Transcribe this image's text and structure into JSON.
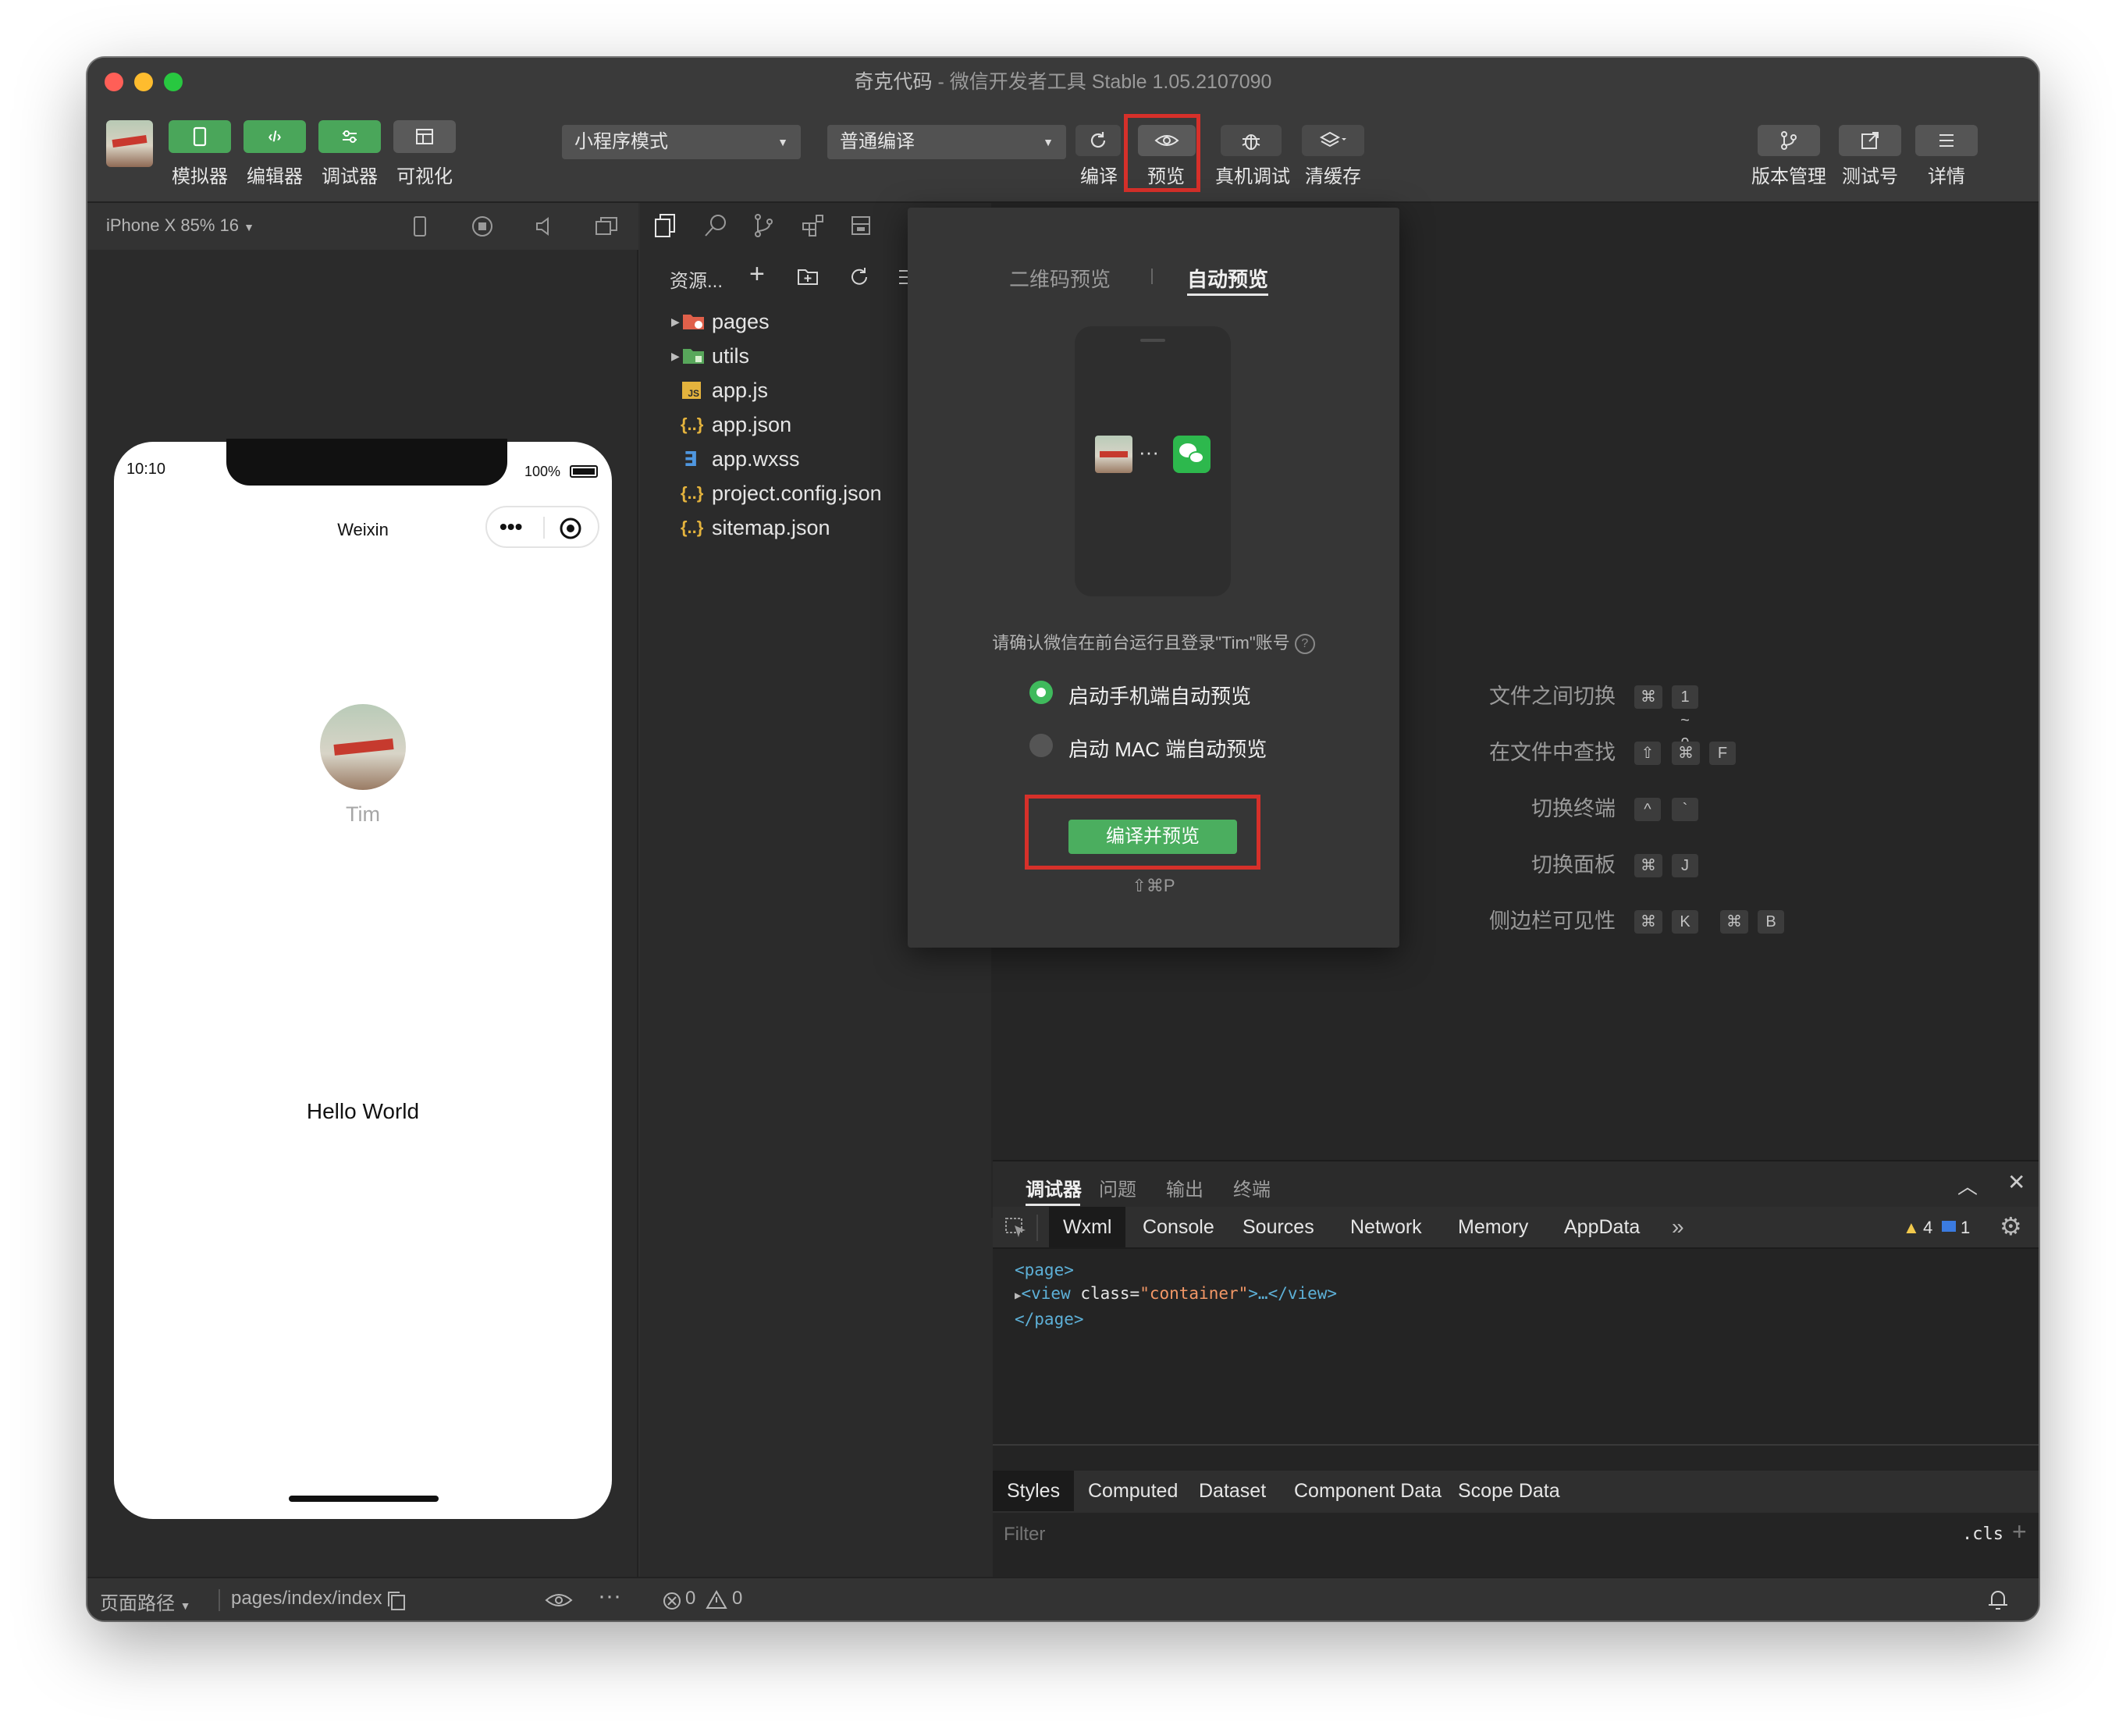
{
  "window": {
    "title_app": "奇克代码",
    "title_rest": " - 微信开发者工具 Stable 1.05.2107090"
  },
  "toolbar": {
    "left_buttons": [
      {
        "label": "模拟器",
        "icon": "phone-icon"
      },
      {
        "label": "编辑器",
        "icon": "code-icon"
      },
      {
        "label": "调试器",
        "icon": "debug-icon"
      },
      {
        "label": "可视化",
        "icon": "layout-icon"
      }
    ],
    "mode_select": "小程序模式",
    "compile_select": "普通编译",
    "compile_label": "编译",
    "preview_label": "预览",
    "remote_debug_label": "真机调试",
    "clear_cache_label": "清缓存",
    "version_label": "版本管理",
    "test_label": "测试号",
    "details_label": "详情"
  },
  "simulator": {
    "device": "iPhone X 85% 16",
    "time": "10:10",
    "battery": "100%",
    "nav_title": "Weixin",
    "user_name": "Tim",
    "hello": "Hello World"
  },
  "explorer": {
    "title": "资源...",
    "files": [
      {
        "name": "pages",
        "type": "folder",
        "icon": "folder-red-icon"
      },
      {
        "name": "utils",
        "type": "folder",
        "icon": "folder-green-icon"
      },
      {
        "name": "app.js",
        "type": "js",
        "icon": "js-file-icon"
      },
      {
        "name": "app.json",
        "type": "json",
        "icon": "json-file-icon"
      },
      {
        "name": "app.wxss",
        "type": "wxss",
        "icon": "css-file-icon"
      },
      {
        "name": "project.config.json",
        "type": "json",
        "icon": "json-file-icon"
      },
      {
        "name": "sitemap.json",
        "type": "json",
        "icon": "json-file-icon"
      }
    ]
  },
  "shortcuts": [
    {
      "label": "文件之间切换",
      "keys": [
        "⌘",
        "1 ~ 9"
      ]
    },
    {
      "label": "在文件中查找",
      "keys": [
        "⇧",
        "⌘",
        "F"
      ]
    },
    {
      "label": "切换终端",
      "keys": [
        "^",
        "`"
      ]
    },
    {
      "label": "切换面板",
      "keys": [
        "⌘",
        "J"
      ]
    },
    {
      "label": "侧边栏可见性",
      "keys": [
        "⌘",
        "K",
        "⌘",
        "B"
      ]
    }
  ],
  "preview_popup": {
    "tab_qr": "二维码预览",
    "tab_auto": "自动预览",
    "notice": "请确认微信在前台运行且登录\"Tim\"账号",
    "option_phone": "启动手机端自动预览",
    "option_mac": "启动 MAC 端自动预览",
    "action_button": "编译并预览",
    "shortcut": "⇧⌘P"
  },
  "debugger": {
    "tabs": [
      "调试器",
      "问题",
      "输出",
      "终端"
    ],
    "devtools_tabs": [
      "Wxml",
      "Console",
      "Sources",
      "Network",
      "Memory",
      "AppData"
    ],
    "warnings": "4",
    "messages": "1",
    "code_lines": [
      {
        "open": "<page>"
      },
      {
        "tag": "view",
        "attr": "class",
        "val": "\"container\"",
        "rest": ">…</view>"
      },
      {
        "close": "</page>"
      }
    ],
    "styles_tabs": [
      "Styles",
      "Computed",
      "Dataset",
      "Component Data",
      "Scope Data"
    ],
    "filter_placeholder": "Filter",
    "cls_label": ".cls"
  },
  "statusbar": {
    "page_path_label": "页面路径",
    "page_path": "pages/index/index",
    "errors": "0",
    "warnings": "0"
  },
  "colors": {
    "accent_green": "#4aa65a",
    "highlight_red": "#d6302a",
    "tag_blue": "#5db0d7",
    "string_orange": "#f29766"
  }
}
